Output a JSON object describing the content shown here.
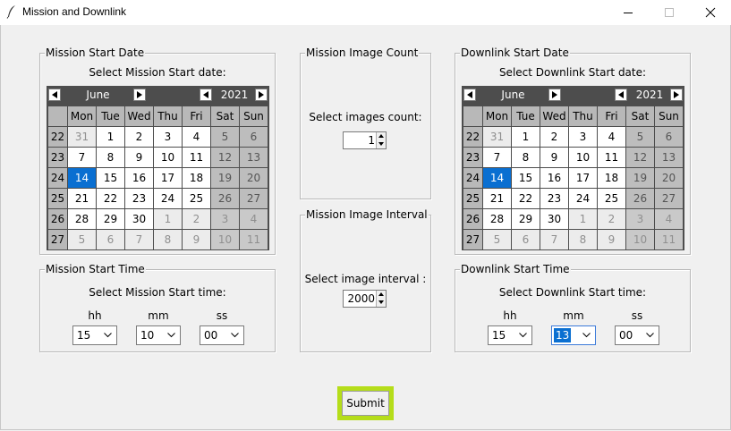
{
  "window": {
    "title": "Mission and Downlink"
  },
  "calendar_common": {
    "day_names": [
      "Mon",
      "Tue",
      "Wed",
      "Thu",
      "Fri",
      "Sat",
      "Sun"
    ],
    "week_numbers": [
      "22",
      "23",
      "24",
      "25",
      "26",
      "27"
    ],
    "days": [
      [
        "31",
        "1",
        "2",
        "3",
        "4",
        "5",
        "6"
      ],
      [
        "7",
        "8",
        "9",
        "10",
        "11",
        "12",
        "13"
      ],
      [
        "14",
        "15",
        "16",
        "17",
        "18",
        "19",
        "20"
      ],
      [
        "21",
        "22",
        "23",
        "24",
        "25",
        "26",
        "27"
      ],
      [
        "28",
        "29",
        "30",
        "1",
        "2",
        "3",
        "4"
      ],
      [
        "5",
        "6",
        "7",
        "8",
        "9",
        "10",
        "11"
      ]
    ],
    "selected_day": "14"
  },
  "mission_date": {
    "legend": "Mission Start Date",
    "prompt": "Select Mission Start date:",
    "month": "June",
    "year": "2021"
  },
  "downlink_date": {
    "legend": "Downlink Start Date",
    "prompt": "Select Downlink Start date:",
    "month": "June",
    "year": "2021"
  },
  "image_count": {
    "legend": "Mission Image Count",
    "prompt": "Select images count:",
    "value": "1"
  },
  "image_interval": {
    "legend": "Mission Image Interval",
    "prompt": "Select image interval :",
    "value": "2000"
  },
  "mission_time": {
    "legend": "Mission Start Time",
    "prompt": "Select Mission Start time:",
    "hh_label": "hh",
    "mm_label": "mm",
    "ss_label": "ss",
    "hh": "15",
    "mm": "10",
    "ss": "00"
  },
  "downlink_time": {
    "legend": "Downlink Start Time",
    "prompt": "Select Downlink Start time:",
    "hh_label": "hh",
    "mm_label": "mm",
    "ss_label": "ss",
    "hh": "15",
    "mm": "13",
    "ss": "00"
  },
  "submit": {
    "label": "Submit"
  },
  "colors": {
    "selected": "#0a6fd1",
    "highlight": "#b5dd1a",
    "calendar_bg": "#4d4d4d"
  }
}
